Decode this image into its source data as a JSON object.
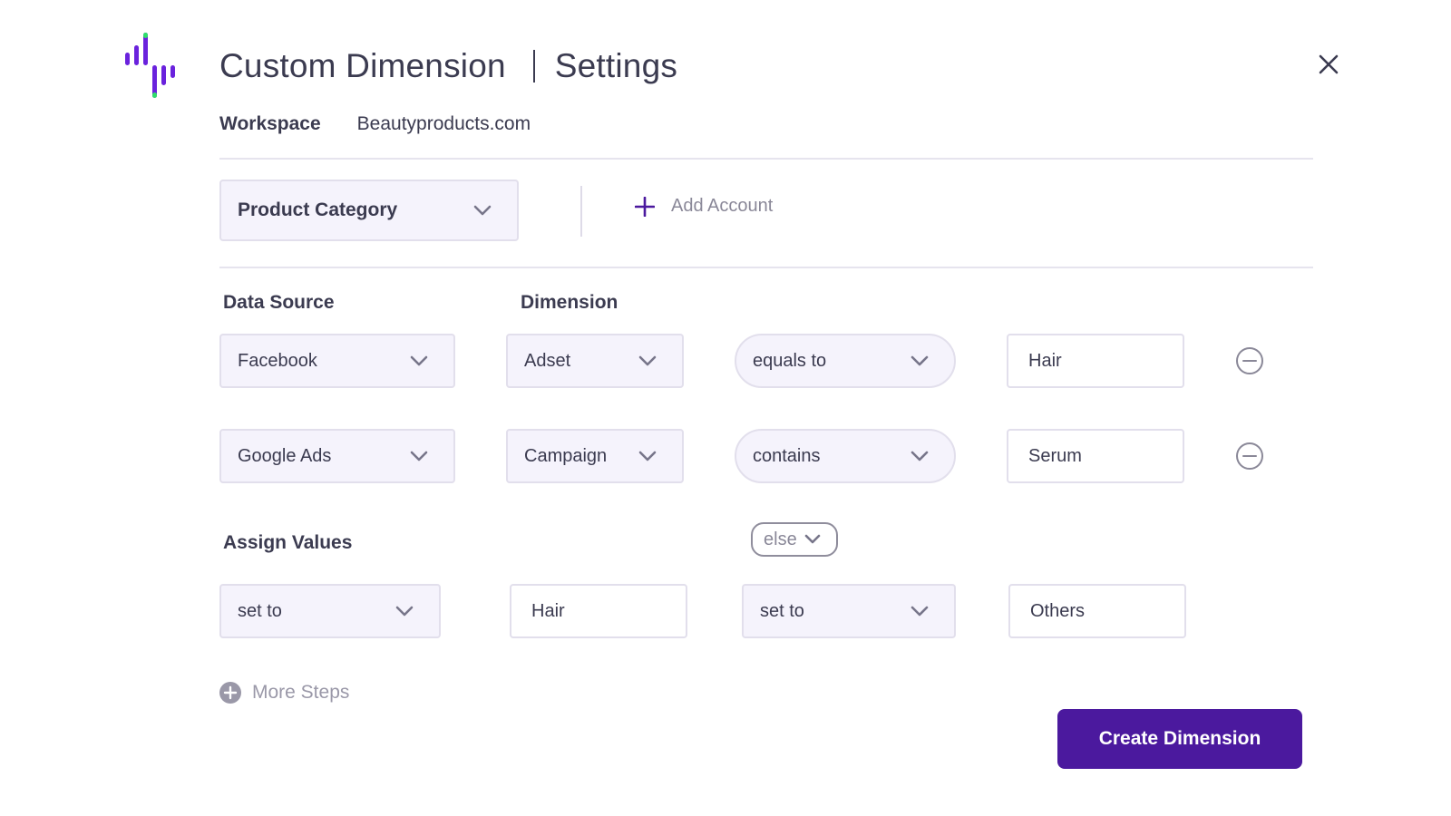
{
  "header": {
    "title": "Custom Dimension",
    "subtitle": "Settings",
    "workspace_label": "Workspace",
    "workspace_value": "Beautyproducts.com"
  },
  "category": {
    "selected": "Product Category"
  },
  "add_account_label": "Add Account",
  "labels": {
    "data_source": "Data Source",
    "dimension": "Dimension",
    "assign_values": "Assign Values"
  },
  "rules": [
    {
      "data_source": "Facebook",
      "dimension": "Adset",
      "operator": "equals to",
      "value": "Hair"
    },
    {
      "data_source": "Google Ads",
      "dimension": "Campaign",
      "operator": "contains",
      "value": "Serum"
    }
  ],
  "assign": {
    "else_label": "else",
    "then_action": "set to",
    "then_value": "Hair",
    "else_action": "set to",
    "else_value": "Others"
  },
  "more_steps_label": "More Steps",
  "create_button_label": "Create Dimension",
  "colors": {
    "accent": "#4b199e",
    "logo_purple": "#6a22dd",
    "logo_green": "#2ee06a",
    "field_bg": "#f5f3fc",
    "field_border": "#e2dfec"
  },
  "icons": [
    "logo-icon",
    "close-icon",
    "chevron-down-icon",
    "plus-icon",
    "remove-circle-icon",
    "add-circle-icon"
  ]
}
